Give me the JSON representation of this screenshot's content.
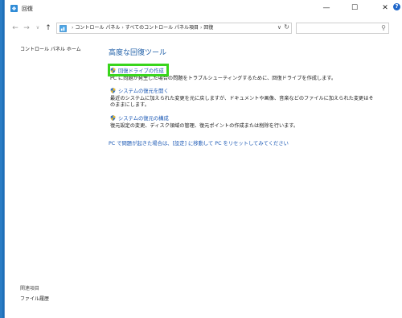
{
  "window": {
    "title": "回復",
    "minimize": "—",
    "maximize": "☐",
    "close": "✕"
  },
  "nav": {
    "back": "←",
    "forward": "→",
    "dropdown": "∨",
    "up": "↑"
  },
  "address": {
    "crumbs": [
      "コントロール パネル",
      "すべてのコントロール パネル項目",
      "回復"
    ],
    "separator": "›",
    "search_placeholder": ""
  },
  "sidebar": {
    "home": "コントロール パネル ホーム",
    "see_also": "関連項目",
    "file_history": "ファイル履歴"
  },
  "main": {
    "title": "高度な回復ツール",
    "items": [
      {
        "link": "回復ドライブの作成",
        "desc": "PC に問題が発生した場合の問題をトラブルシューティングするために、回復ドライブを作成します。"
      },
      {
        "link": "システムの復元を開く",
        "desc": "最近のシステムに加えられた変更を元に戻しますが、ドキュメントや画像、音楽などのファイルに加えられた変更はそのままにします。"
      },
      {
        "link": "システムの復元の構成",
        "desc": "復元設定の変更、ディスク領域の管理、復元ポイントの作成または削除を行います。"
      }
    ],
    "reset_link": "PC で問題が起きた場合は、[設定] に移動して PC をリセットしてみてください"
  },
  "colors": {
    "highlight": "#39d51c",
    "link": "#1c59b5",
    "title": "#1f5fa8"
  }
}
